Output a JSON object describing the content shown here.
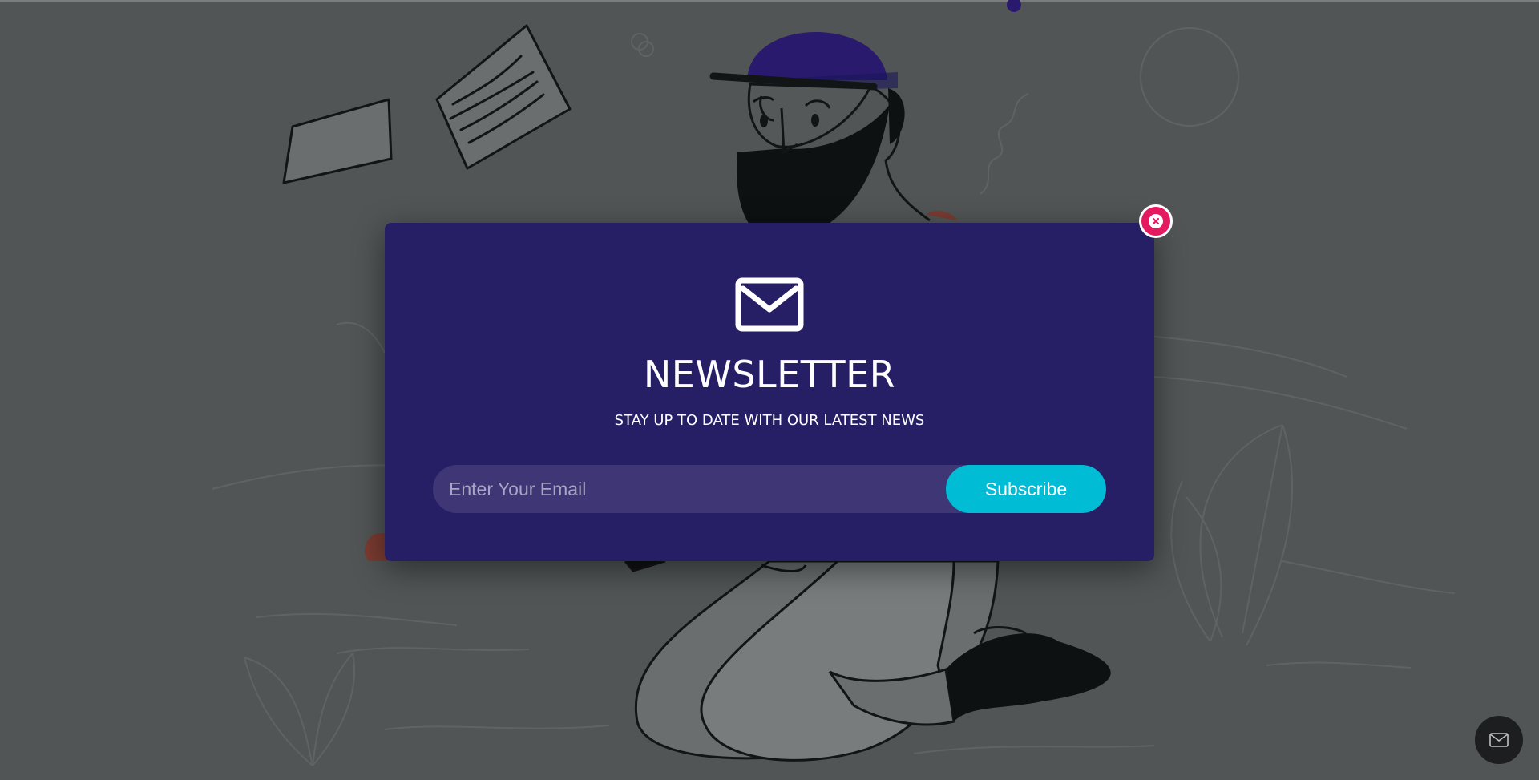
{
  "newsletter_popup": {
    "icon": "envelope-icon",
    "title": "NEWSLETTER",
    "subtitle": "STAY UP TO DATE WITH OUR LATEST NEWS",
    "email_input": {
      "placeholder": "Enter Your Email",
      "value": ""
    },
    "subscribe_label": "Subscribe",
    "close_icon": "close-icon"
  },
  "floating_button": {
    "icon": "envelope-icon"
  },
  "colors": {
    "overlay": "#515556",
    "modal_background": "#271f66",
    "input_background": "#3e3675",
    "subscribe_button": "#00bcd4",
    "close_button": "#e5195f",
    "floating_button": "#1c1e1f",
    "cap": "#2a1a6e"
  }
}
